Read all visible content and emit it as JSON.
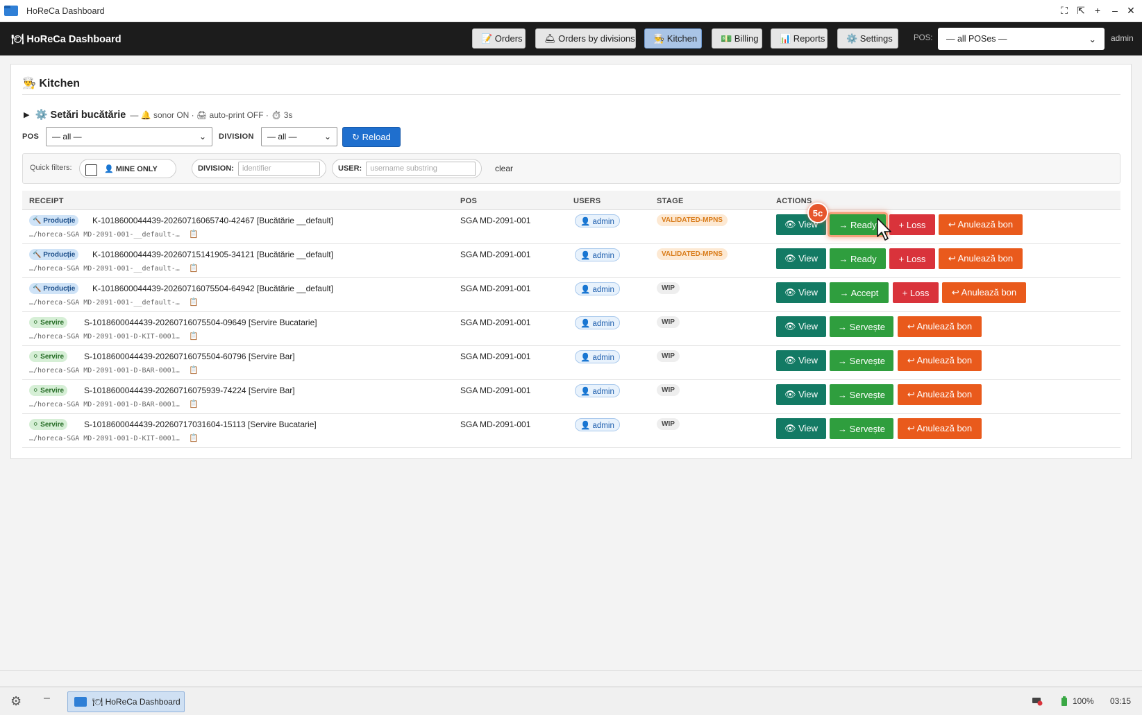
{
  "window": {
    "title": "HoReCa Dashboard",
    "controls": [
      "⛶",
      "⇱",
      "+",
      "–",
      "✕"
    ]
  },
  "navbar": {
    "brand": "🍽 HoReCa Dashboard",
    "tabs": [
      {
        "label": "📝 Orders",
        "active": false
      },
      {
        "label": "🛎 Orders by divisions",
        "active": false
      },
      {
        "label": "👨‍🍳 Kitchen",
        "active": true
      },
      {
        "label": "💵 Billing",
        "active": false
      },
      {
        "label": "📊 Reports",
        "active": false
      },
      {
        "label": "⚙️ Settings",
        "active": false
      }
    ],
    "pos_label": "POS:",
    "pos_value": "— all POSes —",
    "user": "admin"
  },
  "kitchen": {
    "title": "👨‍🍳 Kitchen",
    "settings_caret": "▶",
    "settings_title": "⚙️ Setări bucătărie",
    "settings_summary": "— 🔔 sonor ON · 🖨 auto-print OFF · ⏱ 3s",
    "filter_pos_label": "POS",
    "filter_pos_value": "— all —",
    "filter_division_label": "DIVISION",
    "filter_division_value": "— all —",
    "reload_label": "↻ Reload"
  },
  "quick_filters": {
    "label": "Quick filters:",
    "mine_only": "👤 MINE ONLY",
    "division_label": "DIVISION:",
    "division_placeholder": "identifier",
    "user_label": "USER:",
    "user_placeholder": "username substring",
    "clear": "clear"
  },
  "table": {
    "headers": {
      "receipt": "RECEIPT",
      "pos": "POS",
      "users": "USERS",
      "stage": "STAGE",
      "actions": "ACTIONS"
    },
    "rows": [
      {
        "type": "🔨 Producție",
        "id": "K-1018600044439-20260716065740-42467 [Bucătărie __default]",
        "path": "…/horeca-SGA MD-2091-001-__default-…",
        "pos": "SGA MD-2091-001",
        "user": "👤 admin",
        "stage": "VALIDATED-MPNS",
        "view": "👁 View",
        "primary": "→ Ready",
        "loss": "+ Loss",
        "cancel": "↩ Anulează bon"
      },
      {
        "type": "🔨 Producție",
        "id": "K-1018600044439-20260715141905-34121 [Bucătărie __default]",
        "path": "…/horeca-SGA MD-2091-001-__default-…",
        "pos": "SGA MD-2091-001",
        "user": "👤 admin",
        "stage": "VALIDATED-MPNS",
        "view": "👁 View",
        "primary": "→ Ready",
        "loss": "+ Loss",
        "cancel": "↩ Anulează bon"
      },
      {
        "type": "🔨 Producție",
        "id": "K-1018600044439-20260716075504-64942 [Bucătărie __default]",
        "path": "…/horeca-SGA MD-2091-001-__default-…",
        "pos": "SGA MD-2091-001",
        "user": "👤 admin",
        "stage": "WIP",
        "view": "👁 View",
        "primary": "→ Accept",
        "loss": "+ Loss",
        "cancel": "↩ Anulează bon"
      },
      {
        "type": "⚪ Servire",
        "id": "S-1018600044439-20260716075504-09649 [Servire Bucatarie]",
        "path": "…/horeca-SGA MD-2091-001-D-KIT-0001…",
        "pos": "SGA MD-2091-001",
        "user": "👤 admin",
        "stage": "WIP",
        "view": "👁 View",
        "primary": "→ Servește",
        "cancel": "↩ Anulează bon"
      },
      {
        "type": "⚪ Servire",
        "id": "S-1018600044439-20260716075504-60796 [Servire Bar]",
        "path": "…/horeca-SGA MD-2091-001-D-BAR-0001…",
        "pos": "SGA MD-2091-001",
        "user": "👤 admin",
        "stage": "WIP",
        "view": "👁 View",
        "primary": "→ Servește",
        "cancel": "↩ Anulează bon"
      },
      {
        "type": "⚪ Servire",
        "id": "S-1018600044439-20260716075939-74224 [Servire Bar]",
        "path": "…/horeca-SGA MD-2091-001-D-BAR-0001…",
        "pos": "SGA MD-2091-001",
        "user": "👤 admin",
        "stage": "WIP",
        "view": "👁 View",
        "primary": "→ Servește",
        "cancel": "↩ Anulează bon"
      },
      {
        "type": "⚪ Servire",
        "id": "S-1018600044439-20260717031604-15113 [Servire Bucatarie]",
        "path": "…/horeca-SGA MD-2091-001-D-KIT-0001…",
        "pos": "SGA MD-2091-001",
        "user": "👤 admin",
        "stage": "WIP",
        "view": "👁 View",
        "primary": "→ Servește",
        "cancel": "↩ Anulează bon"
      }
    ]
  },
  "overlay": {
    "step_badge": "5c"
  },
  "taskbar": {
    "gear": "⚙",
    "minimize": "–",
    "task_label": "🍽 HoReCa Dashboard",
    "battery": "100%",
    "clock": "03:15"
  },
  "colors": {
    "nav_bg": "#1c1c1c",
    "view": "#137a64",
    "action_green": "#2f9e3e",
    "loss": "#d9333b",
    "cancel": "#e95a1c",
    "stage_validated": "#d87a17"
  }
}
